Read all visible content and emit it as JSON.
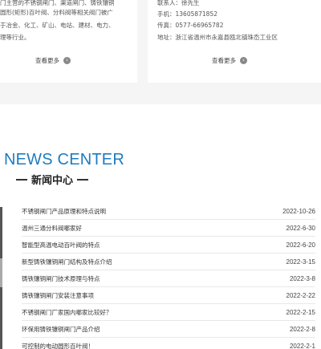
{
  "left_card": {
    "lines": [
      "门主营的不锈钢闸门、渠道闸门、铸铁镶铜",
      "圆形(矩形)百叶阀、分料阀等相关阀门被广",
      "于冶金、化工、矿山、电站、建材、电力、",
      "理等行业。"
    ],
    "more_label": "查看更多"
  },
  "right_card": {
    "lines": [
      "联系人：徐先生",
      "手机：13605871852",
      "传真：0577-66965782",
      "地址：浙江省温州市永嘉县瓯北镇珠岙工业区"
    ],
    "more_label": "查看更多"
  },
  "news": {
    "heading_en": "NEWS CENTER",
    "heading_cn": "新闻中心",
    "items": [
      {
        "title": "不锈钢闸门产品原理和特点说明",
        "date": "2022-10-26"
      },
      {
        "title": "温州三通分料阀哪家好",
        "date": "2022-6-30"
      },
      {
        "title": "智能型高温电动百叶阀的特点",
        "date": "2022-6-20"
      },
      {
        "title": "新型铸铁镶铜闸门结构及特点介绍",
        "date": "2022-3-15"
      },
      {
        "title": "铸铁镶铜闸门技术原理与特点",
        "date": "2022-3-8"
      },
      {
        "title": "铸铁镶铜闸门安装注意事项",
        "date": "2022-2-22"
      },
      {
        "title": "不锈钢闸门厂家国内哪家比较好？",
        "date": "2022-2-15"
      },
      {
        "title": "环保用铸铁镶铜闸门产品介绍",
        "date": "2022-2-8"
      },
      {
        "title": "可控制的电动圆形百叶阀！",
        "date": "2022-2-1"
      }
    ]
  },
  "colors": {
    "accent_blue": "#1e7cc0",
    "band_gray": "#f5f5f5"
  }
}
